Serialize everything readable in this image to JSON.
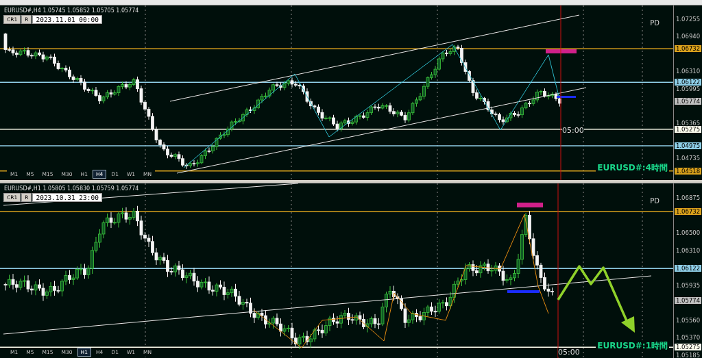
{
  "panels": [
    {
      "header": "EURUSD#,H4  1.05745 1.05852 1.05705 1.05774",
      "buttons": [
        "CR1",
        "R"
      ],
      "date_field": "2023.11.01 00:00",
      "corner_label": "PD",
      "time_label": "05:00",
      "title_label": "EURUSD#:4時間",
      "timeframes": [
        {
          "label": "M1",
          "selected": false
        },
        {
          "label": "M5",
          "selected": false
        },
        {
          "label": "M15",
          "selected": false
        },
        {
          "label": "M30",
          "selected": false
        },
        {
          "label": "H1",
          "selected": false
        },
        {
          "label": "H4",
          "selected": true
        },
        {
          "label": "D1",
          "selected": false
        },
        {
          "label": "W1",
          "selected": false
        },
        {
          "label": "MN",
          "selected": false
        }
      ],
      "price_ticks": [
        "1.07255",
        "1.06940",
        "1.06310",
        "1.05995",
        "1.05365",
        "1.04735"
      ],
      "levels": [
        {
          "price": "1.06732",
          "kind": "level",
          "color": "#d9a11c"
        },
        {
          "price": "1.06122",
          "kind": "level",
          "color": "#8fcfe8"
        },
        {
          "price": "1.05774",
          "kind": "current",
          "color": "#c0c0c0"
        },
        {
          "price": "1.05275",
          "kind": "level",
          "color": "#fffff0"
        },
        {
          "price": "1.04975",
          "kind": "level",
          "color": "#8fcfe8"
        },
        {
          "price": "1.04518",
          "kind": "level",
          "color": "#d9a11c"
        }
      ]
    },
    {
      "header": "EURUSD#,H1  1.05805 1.05830 1.05759 1.05774",
      "buttons": [
        "CR1",
        "R"
      ],
      "date_field": "2023.10.31 23:00",
      "corner_label": "PD",
      "time_label": "05:00",
      "title_label": "EURUSD#:1時間",
      "timeframes": [
        {
          "label": "M1",
          "selected": false
        },
        {
          "label": "M5",
          "selected": false
        },
        {
          "label": "M15",
          "selected": false
        },
        {
          "label": "M30",
          "selected": false
        },
        {
          "label": "H1",
          "selected": true
        },
        {
          "label": "H4",
          "selected": false
        },
        {
          "label": "D1",
          "selected": false
        },
        {
          "label": "W1",
          "selected": false
        },
        {
          "label": "MN",
          "selected": false
        }
      ],
      "price_ticks": [
        "1.06875",
        "1.06500",
        "1.06310",
        "1.05935",
        "1.05560",
        "1.05370",
        "1.05185"
      ],
      "levels": [
        {
          "price": "1.06732",
          "kind": "level",
          "color": "#d9a11c"
        },
        {
          "price": "1.06122",
          "kind": "level",
          "color": "#8fcfe8"
        },
        {
          "price": "1.05774",
          "kind": "current",
          "color": "#c0c0c0"
        },
        {
          "price": "1.05275",
          "kind": "level",
          "color": "#fffff0"
        }
      ]
    }
  ]
}
